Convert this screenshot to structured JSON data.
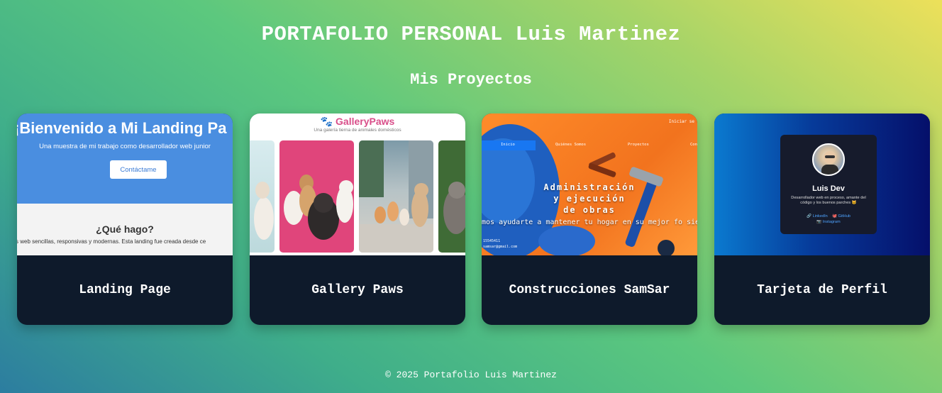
{
  "header": {
    "title": "PORTAFOLIO PERSONAL Luis Martinez",
    "section_title": "Mis Proyectos"
  },
  "projects": [
    {
      "caption": "Landing Page",
      "preview": {
        "heading": "¡Bienvenido a Mi Landing Pa",
        "subtitle": "Una muestra de mi trabajo como desarrollador web junior",
        "button": "Contáctame",
        "question": "¿Qué hago?",
        "body": "s web sencillas, responsivas y modernas. Esta landing fue creada desde ce"
      }
    },
    {
      "caption": "Gallery Paws",
      "preview": {
        "title": "GalleryPaws",
        "subtitle": "Una galería tierna de animales domésticos",
        "logo_icon": "paw-icon"
      }
    },
    {
      "caption": "Construcciones SamSar",
      "preview": {
        "top_link": "Iniciar se",
        "nav": [
          "Inicio",
          "Quiénes Somos",
          "Proyectos",
          "Con"
        ],
        "headline_lines": [
          "Administración",
          "y ejecución",
          "de obras"
        ],
        "lead": "amos ayudarte a mantener tu hogar en su mejor fo siempre!.",
        "contact_lines": [
          "15545411",
          "samsar@gmail.com"
        ]
      }
    },
    {
      "caption": "Tarjeta de Perfil",
      "preview": {
        "name": "Luis Dev",
        "bio": "Desarrollador web en proceso, amante del código y los buenos parches 🐱",
        "links": [
          "LinkedIn",
          "GitHub",
          "Instagram"
        ]
      }
    }
  ],
  "footer": {
    "text": "© 2025 Portafolio Luis Martinez"
  },
  "colors": {
    "card_caption_bg": "#0e1a2b",
    "landing_blue": "#4a8ee0",
    "gallery_pink": "#d94f8a",
    "samsar_orange": "#f2731e",
    "profile_navy": "#050f6a"
  }
}
